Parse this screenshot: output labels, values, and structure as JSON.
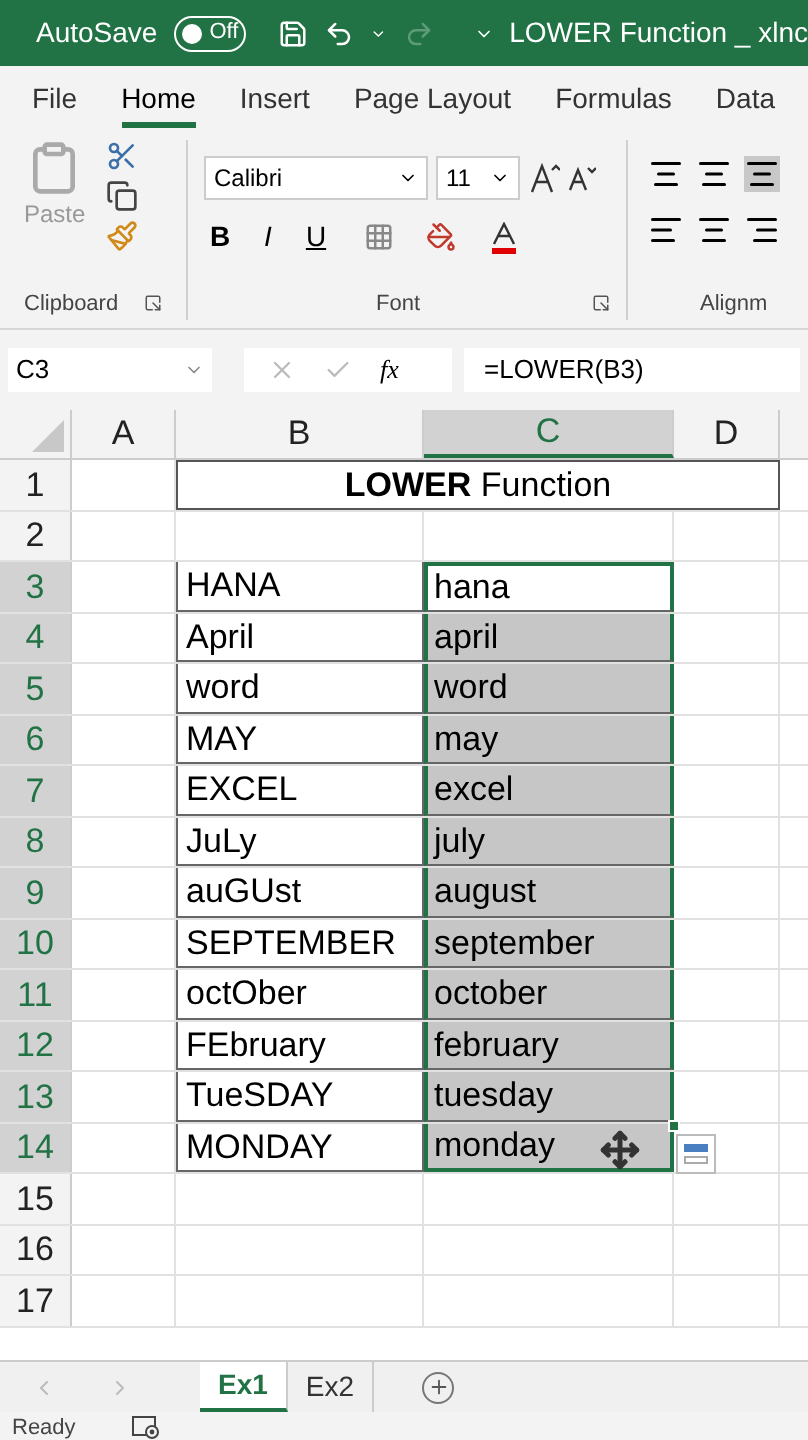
{
  "title_bar": {
    "autosave_label": "AutoSave",
    "autosave_toggle": {
      "label": "Off",
      "on": false
    },
    "title": "LOWER Function _ xlnc"
  },
  "ribbon_tabs": [
    {
      "label": "File",
      "selected": false
    },
    {
      "label": "Home",
      "selected": true
    },
    {
      "label": "Insert",
      "selected": false
    },
    {
      "label": "Page Layout",
      "selected": false
    },
    {
      "label": "Formulas",
      "selected": false
    },
    {
      "label": "Data",
      "selected": false
    }
  ],
  "ribbon": {
    "paste_label": "Paste",
    "clipboard_label": "Clipboard",
    "font_name": "Calibri",
    "font_size": "11",
    "format_buttons": [
      "B",
      "I",
      "U"
    ],
    "font_label": "Font",
    "alignment_label": "Alignm"
  },
  "formula_bar": {
    "name_box": "C3",
    "function_button": "fx",
    "formula": "=LOWER(B3)"
  },
  "columns": [
    {
      "label": "A",
      "selected": false
    },
    {
      "label": "B",
      "selected": false
    },
    {
      "label": "C",
      "selected": true
    },
    {
      "label": "D",
      "selected": false
    }
  ],
  "rows": [
    {
      "number": "1",
      "selected": false,
      "title": "**LOWER** Function"
    },
    {
      "number": "2",
      "selected": false
    },
    {
      "number": "3",
      "selected": true,
      "b": "HANA",
      "c": {
        "text": "hana",
        "selected": true,
        "active": true
      }
    },
    {
      "number": "4",
      "selected": true,
      "b": "April",
      "c": {
        "text": "april",
        "selected": true,
        "active": false
      }
    },
    {
      "number": "5",
      "selected": true,
      "b": "word",
      "c": {
        "text": "word",
        "selected": true,
        "active": false
      }
    },
    {
      "number": "6",
      "selected": true,
      "b": "MAY",
      "c": {
        "text": "may",
        "selected": true,
        "active": false
      }
    },
    {
      "number": "7",
      "selected": true,
      "b": "EXCEL",
      "c": {
        "text": "excel",
        "selected": true,
        "active": false
      }
    },
    {
      "number": "8",
      "selected": true,
      "b": "JuLy",
      "c": {
        "text": "july",
        "selected": true,
        "active": false
      }
    },
    {
      "number": "9",
      "selected": true,
      "b": "auGUst",
      "c": {
        "text": "august",
        "selected": true,
        "active": false
      }
    },
    {
      "number": "10",
      "selected": true,
      "b": "SEPTEMBER",
      "c": {
        "text": "september",
        "selected": true,
        "active": false
      }
    },
    {
      "number": "11",
      "selected": true,
      "b": "octOber",
      "c": {
        "text": "october",
        "selected": true,
        "active": false
      }
    },
    {
      "number": "12",
      "selected": true,
      "b": "FEbruary",
      "c": {
        "text": "february",
        "selected": true,
        "active": false
      }
    },
    {
      "number": "13",
      "selected": true,
      "b": "TueSDAY",
      "c": {
        "text": "tuesday",
        "selected": true,
        "active": false
      }
    },
    {
      "number": "14",
      "selected": true,
      "b": "MONDAY",
      "c": {
        "text": "monday",
        "selected": true,
        "active": false
      }
    },
    {
      "number": "15",
      "selected": false
    },
    {
      "number": "16",
      "selected": false
    },
    {
      "number": "17",
      "selected": false
    }
  ],
  "sheet_tabs": [
    {
      "label": "Ex1",
      "selected": true
    },
    {
      "label": "Ex2",
      "selected": false
    }
  ],
  "status_bar": {
    "status": "Ready"
  }
}
